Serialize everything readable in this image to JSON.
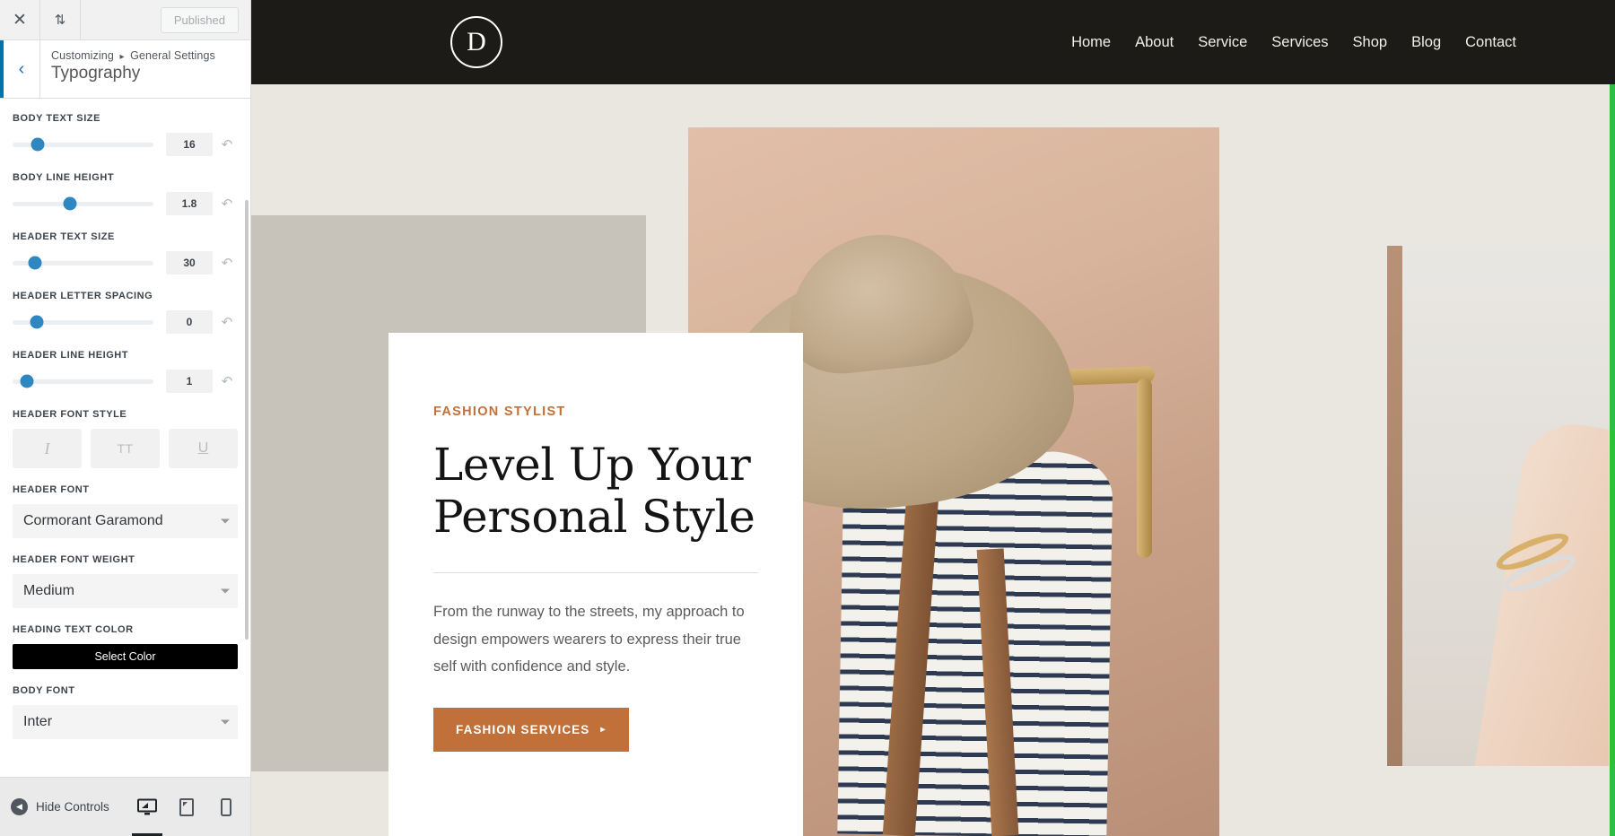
{
  "customizer": {
    "topbar": {
      "close_icon": "close-icon",
      "devices_icon": "collapse-expand-icon",
      "published_label": "Published"
    },
    "panel": {
      "back_icon": "chevron-left-icon",
      "breadcrumb_root": "Customizing",
      "breadcrumb_sep": "▸",
      "breadcrumb_parent": "General Settings",
      "title": "Typography"
    },
    "controls": [
      {
        "label": "BODY TEXT SIZE",
        "value": "16",
        "knob_pct": 18,
        "reset_icon": "undo-icon"
      },
      {
        "label": "BODY LINE HEIGHT",
        "value": "1.8",
        "knob_pct": 41,
        "reset_icon": "undo-icon"
      },
      {
        "label": "HEADER TEXT SIZE",
        "value": "30",
        "knob_pct": 16,
        "reset_icon": "undo-icon"
      },
      {
        "label": "HEADER LETTER SPACING",
        "value": "0",
        "knob_pct": 17,
        "reset_icon": "undo-icon"
      },
      {
        "label": "HEADER LINE HEIGHT",
        "value": "1",
        "knob_pct": 10,
        "reset_icon": "undo-icon"
      }
    ],
    "font_style": {
      "label": "HEADER FONT STYLE",
      "buttons": [
        {
          "glyph": "I",
          "name": "italic-button"
        },
        {
          "glyph": "TT",
          "name": "uppercase-button"
        },
        {
          "glyph": "U",
          "name": "underline-button"
        }
      ]
    },
    "header_font": {
      "label": "HEADER FONT",
      "value": "Cormorant Garamond"
    },
    "header_font_weight": {
      "label": "HEADER FONT WEIGHT",
      "value": "Medium"
    },
    "heading_color": {
      "label": "HEADING TEXT COLOR",
      "button_label": "Select Color",
      "swatch": "#000000"
    },
    "body_font": {
      "label": "BODY FONT",
      "value": "Inter"
    },
    "footer": {
      "hide_controls_label": "Hide Controls",
      "hide_icon": "chevron-left-circle-icon",
      "devices": [
        {
          "name": "desktop-preview-button",
          "icon": "desktop-icon",
          "active": true
        },
        {
          "name": "tablet-preview-button",
          "icon": "tablet-icon",
          "active": false
        },
        {
          "name": "mobile-preview-button",
          "icon": "mobile-icon",
          "active": false
        }
      ]
    }
  },
  "preview": {
    "logo_letter": "D",
    "nav": [
      "Home",
      "About",
      "Service",
      "Services",
      "Shop",
      "Blog",
      "Contact"
    ],
    "hero": {
      "eyebrow": "FASHION STYLIST",
      "title_line1": "Level Up Your",
      "title_line2": "Personal Style",
      "body": "From the runway to the streets, my approach to design empowers wearers to express their true self with confidence and style.",
      "cta_label": "FASHION SERVICES",
      "cta_arrow": "▸"
    },
    "colors": {
      "header_bg": "#1d1b18",
      "accent": "#c2703a",
      "stage_bg": "#eae7e1",
      "band": "#c7c3bb",
      "focus_edge": "#2fbf3d"
    }
  }
}
